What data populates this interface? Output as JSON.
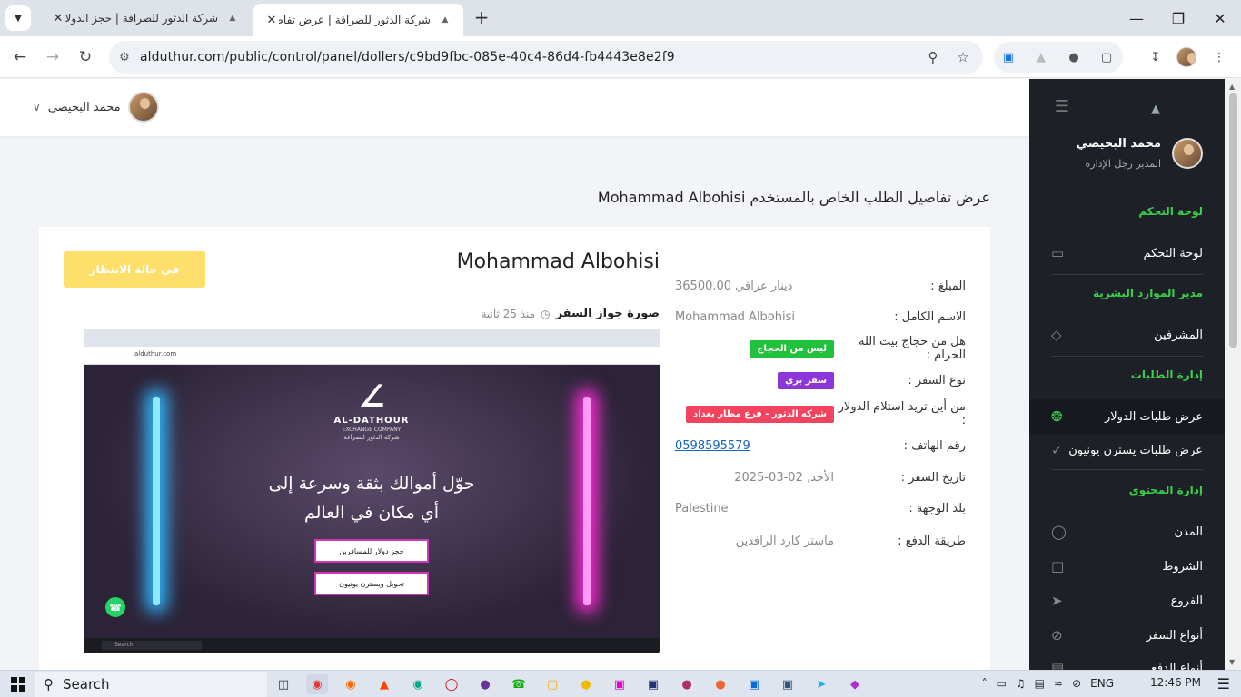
{
  "browser": {
    "tabs": [
      {
        "title": "شركة الدثور للصرافة | حجز الدولار"
      },
      {
        "title": "شركة الدثور للصرافة | عرض تفاص"
      }
    ],
    "url": "alduthur.com/public/control/panel/dollers/c9bd9fbc-085e-40c4-86d4-fb4443e8e2f9"
  },
  "topbar": {
    "user_name": "محمد البحيصي"
  },
  "sidebar": {
    "user_name": "محمد البحيصي",
    "user_role": "المدير رجل الإدارة",
    "sections": [
      {
        "title": "لوحة التحكم",
        "items": [
          {
            "label": "لوحة التحكم",
            "icon": "monitor-icon"
          }
        ]
      },
      {
        "title": "مدير الموارد البشرية",
        "items": [
          {
            "label": "المشرفين",
            "icon": "diamond-icon"
          }
        ]
      },
      {
        "title": "إدارة الطلبات",
        "items": [
          {
            "label": "عرض طلبات الدولار",
            "icon": "aperture-icon"
          },
          {
            "label": "عرض طلبات يسترن يونيون",
            "icon": "check-circle-icon"
          }
        ]
      },
      {
        "title": "إدارة المحتوى",
        "items": [
          {
            "label": "المدن",
            "icon": "ball-icon"
          },
          {
            "label": "الشروط",
            "icon": "file-icon"
          },
          {
            "label": "الفروع",
            "icon": "send-icon"
          },
          {
            "label": "أنواع السفر",
            "icon": "block-icon"
          },
          {
            "label": "أنواع الدفع",
            "icon": "card-icon"
          }
        ]
      }
    ]
  },
  "page": {
    "heading": "عرض تفاصيل الطلب الخاص بالمستخدم Mohammad Albohisi",
    "customer_name": "Mohammad Albohisi",
    "status_button": "في حالة الانتظار",
    "passport_label": "صورة جواز السفر",
    "passport_time": "منذ 25 ثانية",
    "details": [
      {
        "label": "المبلغ :",
        "value": "36500.00 دينار عراقي"
      },
      {
        "label": "الاسم الكامل :",
        "value": "Mohammad Albohisi"
      },
      {
        "label": "هل من حجاج بيت الله الحرام :",
        "badge": "ليس من الحجاج",
        "badge_color": "#21c13c"
      },
      {
        "label": "نوع السفر :",
        "badge": "سفر بري",
        "badge_color": "#8e35d8"
      },
      {
        "label": "من أين تريد استلام الدولار :",
        "badge": "شركه الدثور - فرع مطار بغداد",
        "badge_color": "#f2445e"
      },
      {
        "label": "رقم الهاتف :",
        "value": "0598595579",
        "link": true
      },
      {
        "label": "تاريخ السفر :",
        "value": "الأحد, 02-03-2025"
      },
      {
        "label": "بلد الوجهة :",
        "value": "Palestine"
      },
      {
        "label": "طريقة الدفع :",
        "value": "ماستر كارد الرافدين"
      }
    ]
  },
  "passport_image": {
    "address": "alduthur.com",
    "brand": "AL-DATHOUR",
    "brand_sub": "EXCHANGE COMPANY",
    "brand_ar": "شركة الدثور للصرافة",
    "headline1": "حوّل أموالك بثقة وسرعة إلى",
    "headline2": "أي مكان في العالم",
    "button1": "حجز دولار للمسافرين",
    "button2": "تحويل ويسترن يونيون",
    "search": "Search"
  },
  "taskbar": {
    "search": "Search",
    "lang": "ENG",
    "time": "12:46 PM"
  }
}
